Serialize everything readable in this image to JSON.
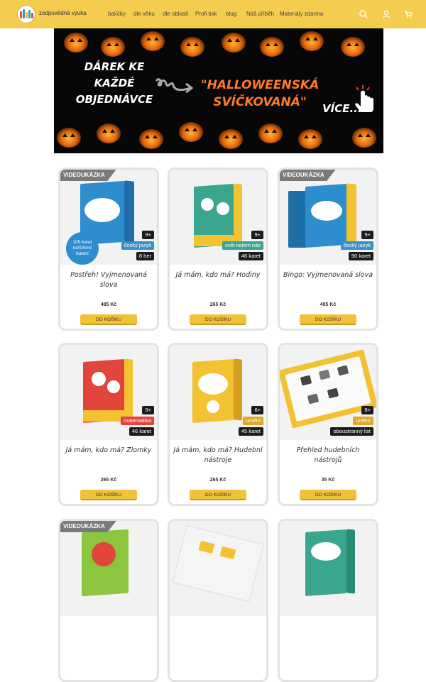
{
  "header": {
    "logo_text": "zodpovědná výuka",
    "nav": [
      "balíčky",
      "dle věku",
      "dle oblastí",
      "Profi tisk",
      "blog",
      "Náš příběh",
      "Materiály zdarma"
    ],
    "icons": [
      "search-icon",
      "user-icon",
      "cart-icon"
    ]
  },
  "banner": {
    "left_line1": "DÁREK KE KAŽDÉ",
    "left_line2": "OBJEDNÁVCE",
    "right_line1": "\"HALLOWEENSKÁ",
    "right_line2": "SVÍČKOVANÁ\"",
    "more": "VÍCE..."
  },
  "products": [
    {
      "video": "VIDEOUKÁZKA",
      "age": "9+",
      "topic": "český jazyk",
      "count": "8 her",
      "bubble": "105 karet rozšířené balení",
      "title": "Postřeh! Vyjmenovaná slova",
      "price": "485 Kč",
      "button": "DO KOŠÍKU"
    },
    {
      "video": "",
      "age": "9+",
      "topic": "svět kolem nás",
      "count": "46 karet",
      "bubble": "",
      "title": "Já mám, kdo má? Hodiny",
      "price": "265 Kč",
      "button": "DO KOŠÍKU"
    },
    {
      "video": "VIDEOUKÁZKA",
      "age": "9+",
      "topic": "český jazyk",
      "count": "90 karet",
      "bubble": "",
      "title": "Bingo: Vyjmenovaná slova",
      "price": "485 Kč",
      "button": "DO KOŠÍKU"
    },
    {
      "video": "",
      "age": "9+",
      "topic": "matematika",
      "count": "46 karet",
      "bubble": "",
      "title": "Já mám, kdo má? Zlomky",
      "price": "265 Kč",
      "button": "DO KOŠÍKU"
    },
    {
      "video": "",
      "age": "6+",
      "topic": "umění",
      "count": "45 karet",
      "bubble": "",
      "title": "Já mám, kdo má? Hudební nástroje",
      "price": "265 Kč",
      "button": "DO KOŠÍKU"
    },
    {
      "video": "",
      "age": "8+",
      "topic": "umění",
      "count": "oboustranný list",
      "bubble": "",
      "title": "Přehled hudebních nástrojů",
      "price": "35 Kč",
      "button": "DO KOŠÍKU"
    },
    {
      "video": "VIDEOUKÁZKA",
      "age": "",
      "topic": "",
      "count": "",
      "bubble": "",
      "title": "",
      "price": "",
      "button": ""
    },
    {
      "video": "",
      "age": "",
      "topic": "",
      "count": "",
      "bubble": "",
      "title": "",
      "price": "",
      "button": ""
    },
    {
      "video": "",
      "age": "",
      "topic": "",
      "count": "",
      "bubble": "",
      "title": "",
      "price": "",
      "button": ""
    }
  ],
  "colors": {
    "header": "#f4cc4e",
    "button": "#f1c238",
    "banner_orange": "#ff7a2a"
  }
}
